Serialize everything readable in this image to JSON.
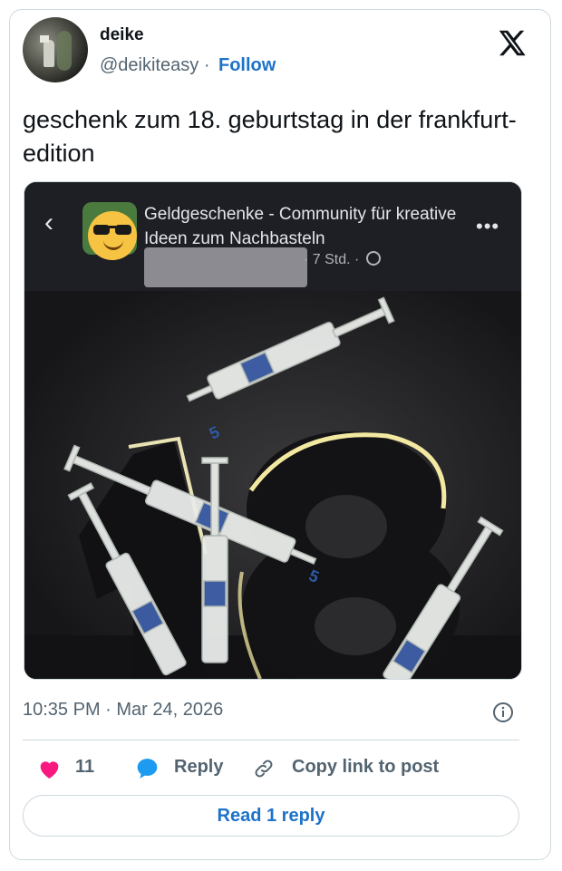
{
  "author": {
    "name": "deike",
    "handle": "@deikiteasy",
    "separator": "·",
    "follow_label": "Follow"
  },
  "tweet": {
    "text": "geschenk zum 18. geburtstag in der frankfurt-edition",
    "timestamp": "10:35 PM · Mar 24, 2026"
  },
  "embedded_post": {
    "group_name": "Geldgeschenke - Community für kreative Ideen zum Nachbasteln",
    "meta": "· 7 Std. ·",
    "back_icon": "chevron-left-icon",
    "more_icon": "more-dots-icon",
    "photo_text": "5"
  },
  "stats": {
    "like_count": "11",
    "reply_label": "Reply",
    "copy_link_label": "Copy link to post"
  },
  "read_reply_label": "Read 1 reply",
  "colors": {
    "accent": "#1d72c9",
    "heart": "#f91880",
    "reply_icon": "#1d9bf0",
    "muted": "#536471"
  }
}
